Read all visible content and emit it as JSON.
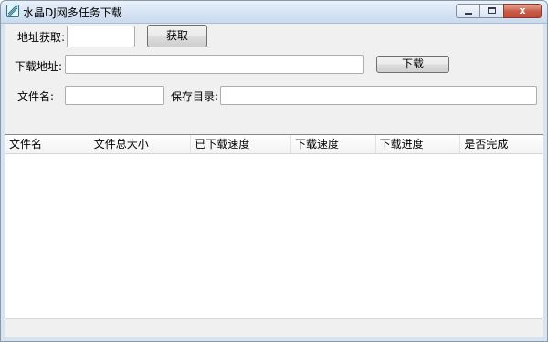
{
  "window": {
    "title": "水晶DJ网多任务下载",
    "min_label": "",
    "max_label": "",
    "close_label": "x"
  },
  "form": {
    "addr_fetch_label": "地址获取:",
    "addr_fetch_value": "",
    "fetch_button": "获取",
    "download_addr_label": "下载地址:",
    "download_addr_value": "",
    "download_button": "下载",
    "filename_label": "文件名:",
    "filename_value": "",
    "save_dir_label": "保存目录:",
    "save_dir_value": ""
  },
  "list": {
    "columns": [
      "文件名",
      "文件总大小",
      "已下载速度",
      "下载速度",
      "下载进度",
      "是否完成"
    ],
    "rows": []
  },
  "status": {
    "text": ""
  }
}
